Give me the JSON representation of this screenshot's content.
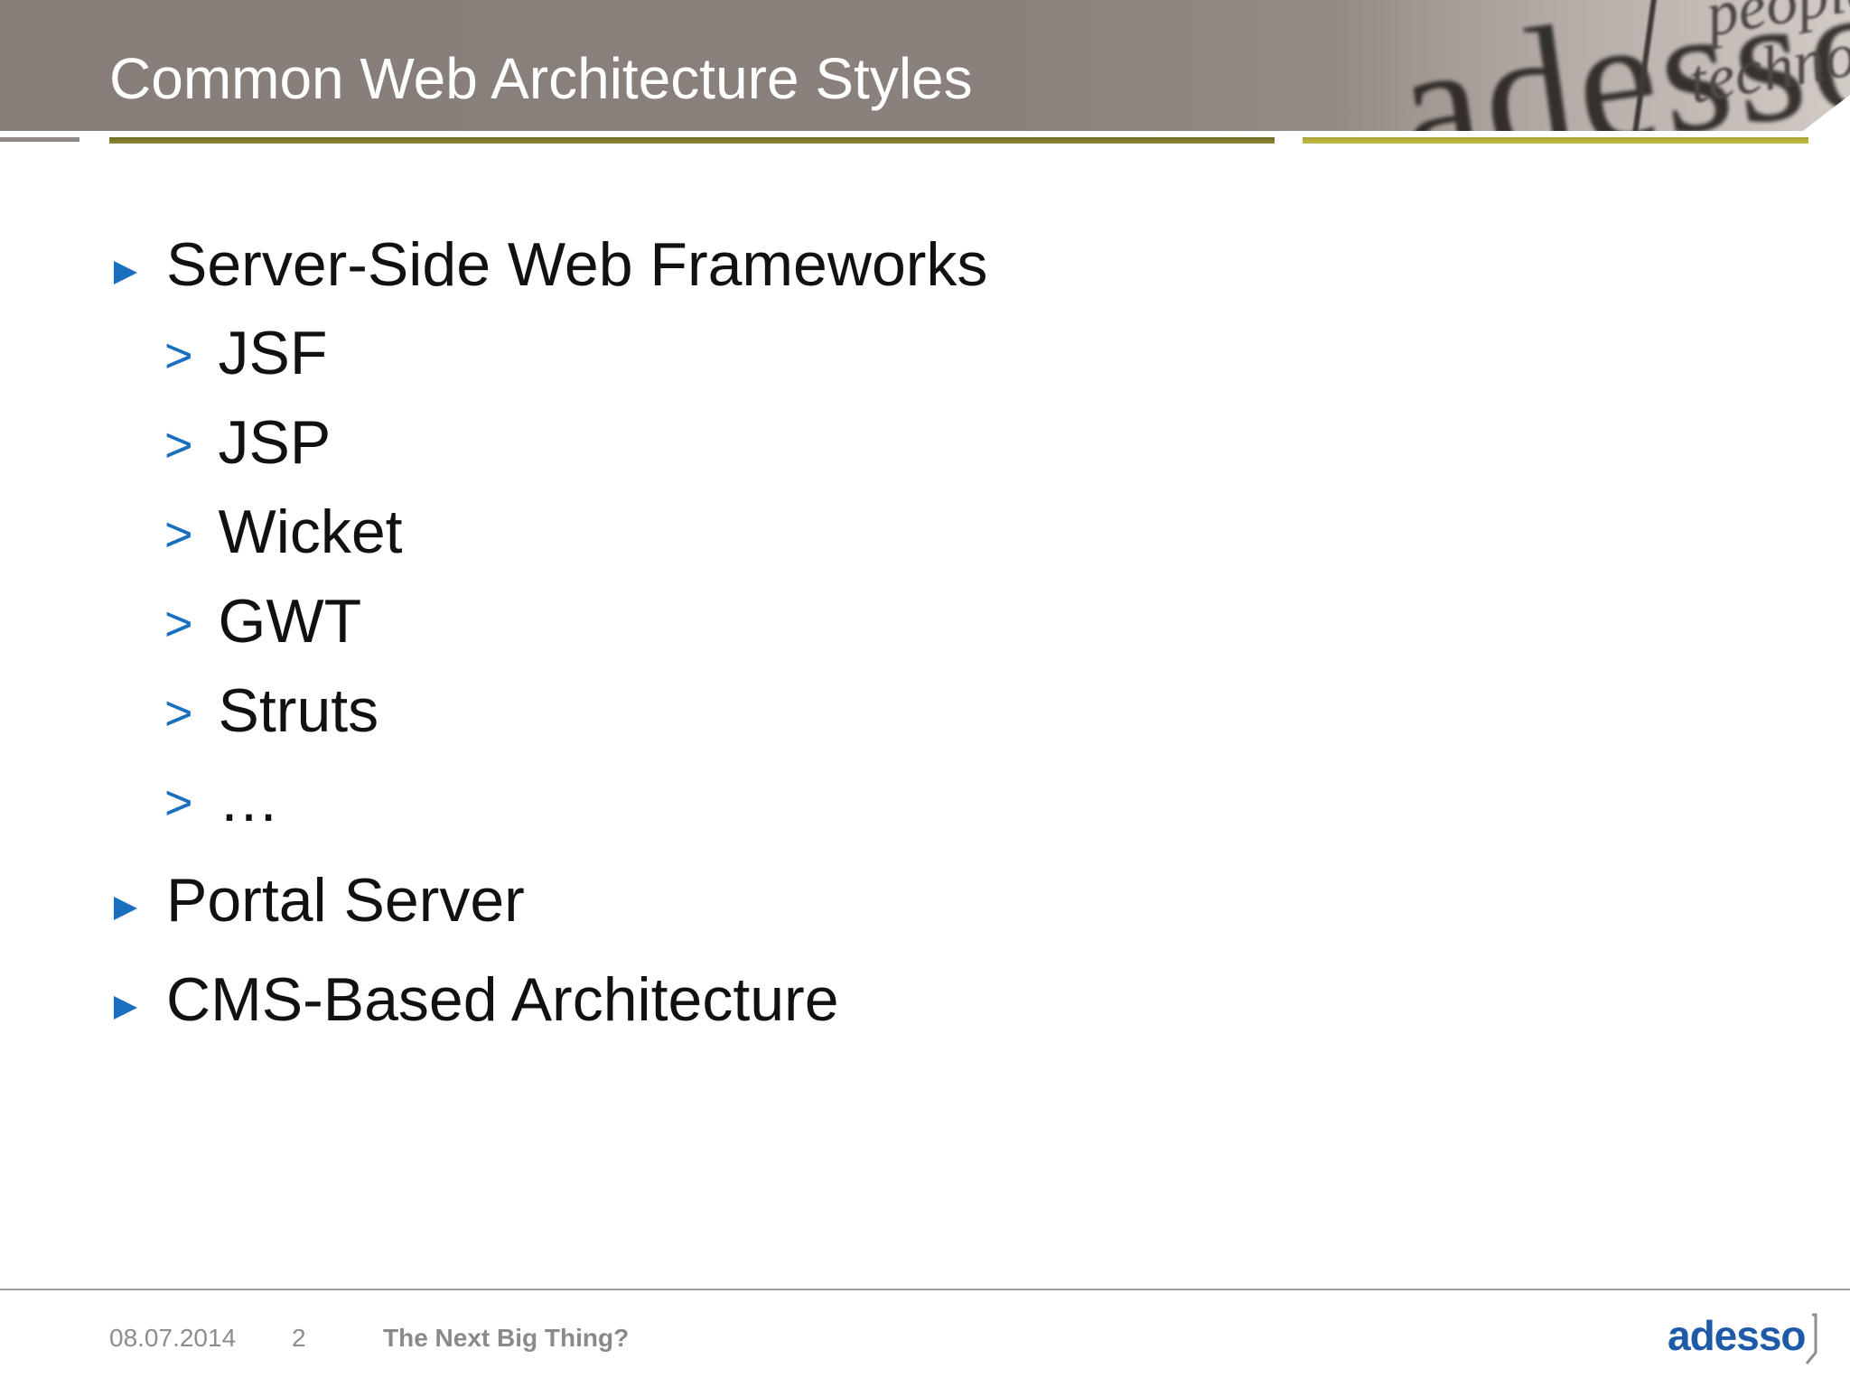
{
  "slide": {
    "title": "Common Web Architecture Styles"
  },
  "header_photo": {
    "word": "adesso",
    "tag_line1": "people",
    "tag_line2": "technology"
  },
  "bullets": [
    {
      "label": "Server-Side Web Frameworks",
      "sub": [
        "JSF",
        "JSP",
        "Wicket",
        "GWT",
        "Struts",
        "…"
      ]
    },
    {
      "label": "Portal Server",
      "sub": []
    },
    {
      "label": "CMS-Based Architecture",
      "sub": []
    }
  ],
  "footer": {
    "date": "08.07.2014",
    "page": "2",
    "topic": "The Next Big Thing?",
    "logo": "adesso"
  },
  "colors": {
    "header": "#877e79",
    "bullet_blue": "#1a6fbf",
    "olive_rule": "#7e7b2c",
    "yellow_rule": "#bdb73c",
    "logo_blue": "#1f5aa8"
  }
}
